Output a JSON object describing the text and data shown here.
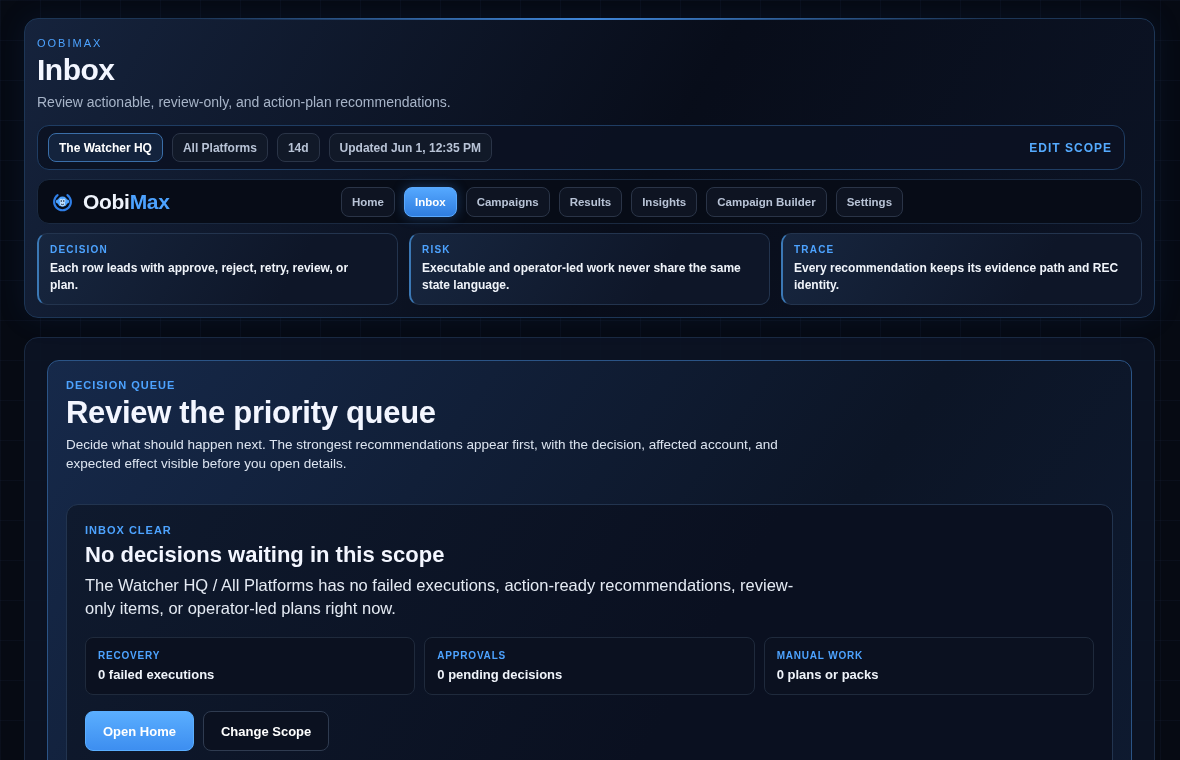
{
  "header": {
    "eyebrow": "OOBIMAX",
    "title": "Inbox",
    "subtitle": "Review actionable, review-only, and action-plan recommendations."
  },
  "scope_bar": {
    "chips": [
      {
        "label": "The Watcher HQ",
        "selected": true
      },
      {
        "label": "All Platforms",
        "selected": false
      },
      {
        "label": "14d",
        "selected": false
      },
      {
        "label": "Updated Jun 1, 12:35 PM",
        "selected": false
      }
    ],
    "action": "EDIT SCOPE"
  },
  "nav": {
    "brand": {
      "text": "Oobi",
      "accent_text": "Max"
    },
    "items": [
      {
        "label": "Home",
        "selected": false
      },
      {
        "label": "Inbox",
        "selected": true
      },
      {
        "label": "Campaigns",
        "selected": false
      },
      {
        "label": "Results",
        "selected": false
      },
      {
        "label": "Insights",
        "selected": false
      },
      {
        "label": "Campaign Builder",
        "selected": false
      },
      {
        "label": "Settings",
        "selected": false
      }
    ]
  },
  "principles": [
    {
      "label": "DECISION",
      "text": "Each row leads with approve, reject, retry, review, or plan."
    },
    {
      "label": "RISK",
      "text": "Executable and operator-led work never share the same state language."
    },
    {
      "label": "TRACE",
      "text": "Every recommendation keeps its evidence path and REC identity."
    }
  ],
  "queue": {
    "eyebrow": "DECISION QUEUE",
    "title": "Review the priority queue",
    "description": "Decide what should happen next. The strongest recommendations appear first, with the decision, affected account, and expected effect visible before you open details.",
    "empty_state": {
      "eyebrow": "INBOX CLEAR",
      "title": "No decisions waiting in this scope",
      "message": "The Watcher HQ / All Platforms has no failed executions, action-ready recommendations, review-only items, or operator-led plans right now.",
      "stats": [
        {
          "label": "RECOVERY",
          "value": "0 failed executions"
        },
        {
          "label": "APPROVALS",
          "value": "0 pending decisions"
        },
        {
          "label": "MANUAL WORK",
          "value": "0 plans or packs"
        }
      ],
      "buttons": [
        {
          "label": "Open Home",
          "kind": "primary"
        },
        {
          "label": "Change Scope",
          "kind": "secondary"
        }
      ]
    }
  }
}
